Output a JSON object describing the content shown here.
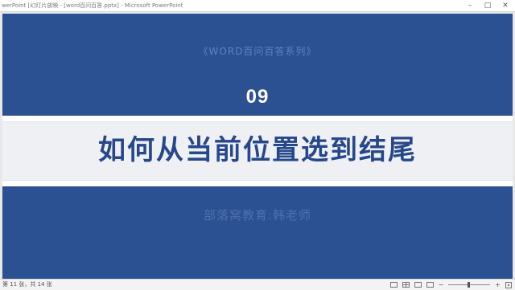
{
  "window": {
    "title": "werPoint [幻灯片放映 - [word百问百答.pptx] - Microsoft PowerPoint",
    "controls": {
      "minimize_glyph": "–",
      "maximize_glyph": "□",
      "close_glyph": "✕"
    }
  },
  "slide": {
    "subtitle": "《WORD百问百答系列》",
    "number": "09",
    "title": "如何从当前位置选到结尾",
    "author": "部落窝教育:韩老师",
    "colors": {
      "background": "#2b5193",
      "band": "#eef0f4",
      "title": "#27478b"
    }
  },
  "statusbar": {
    "slide_info": "第 11 张，共 14 张",
    "zoom_minus": "−",
    "zoom_plus": "+",
    "icons": [
      "normal-view-icon",
      "slide-sorter-icon",
      "reading-view-icon",
      "slideshow-icon",
      "fit-window-icon"
    ]
  }
}
